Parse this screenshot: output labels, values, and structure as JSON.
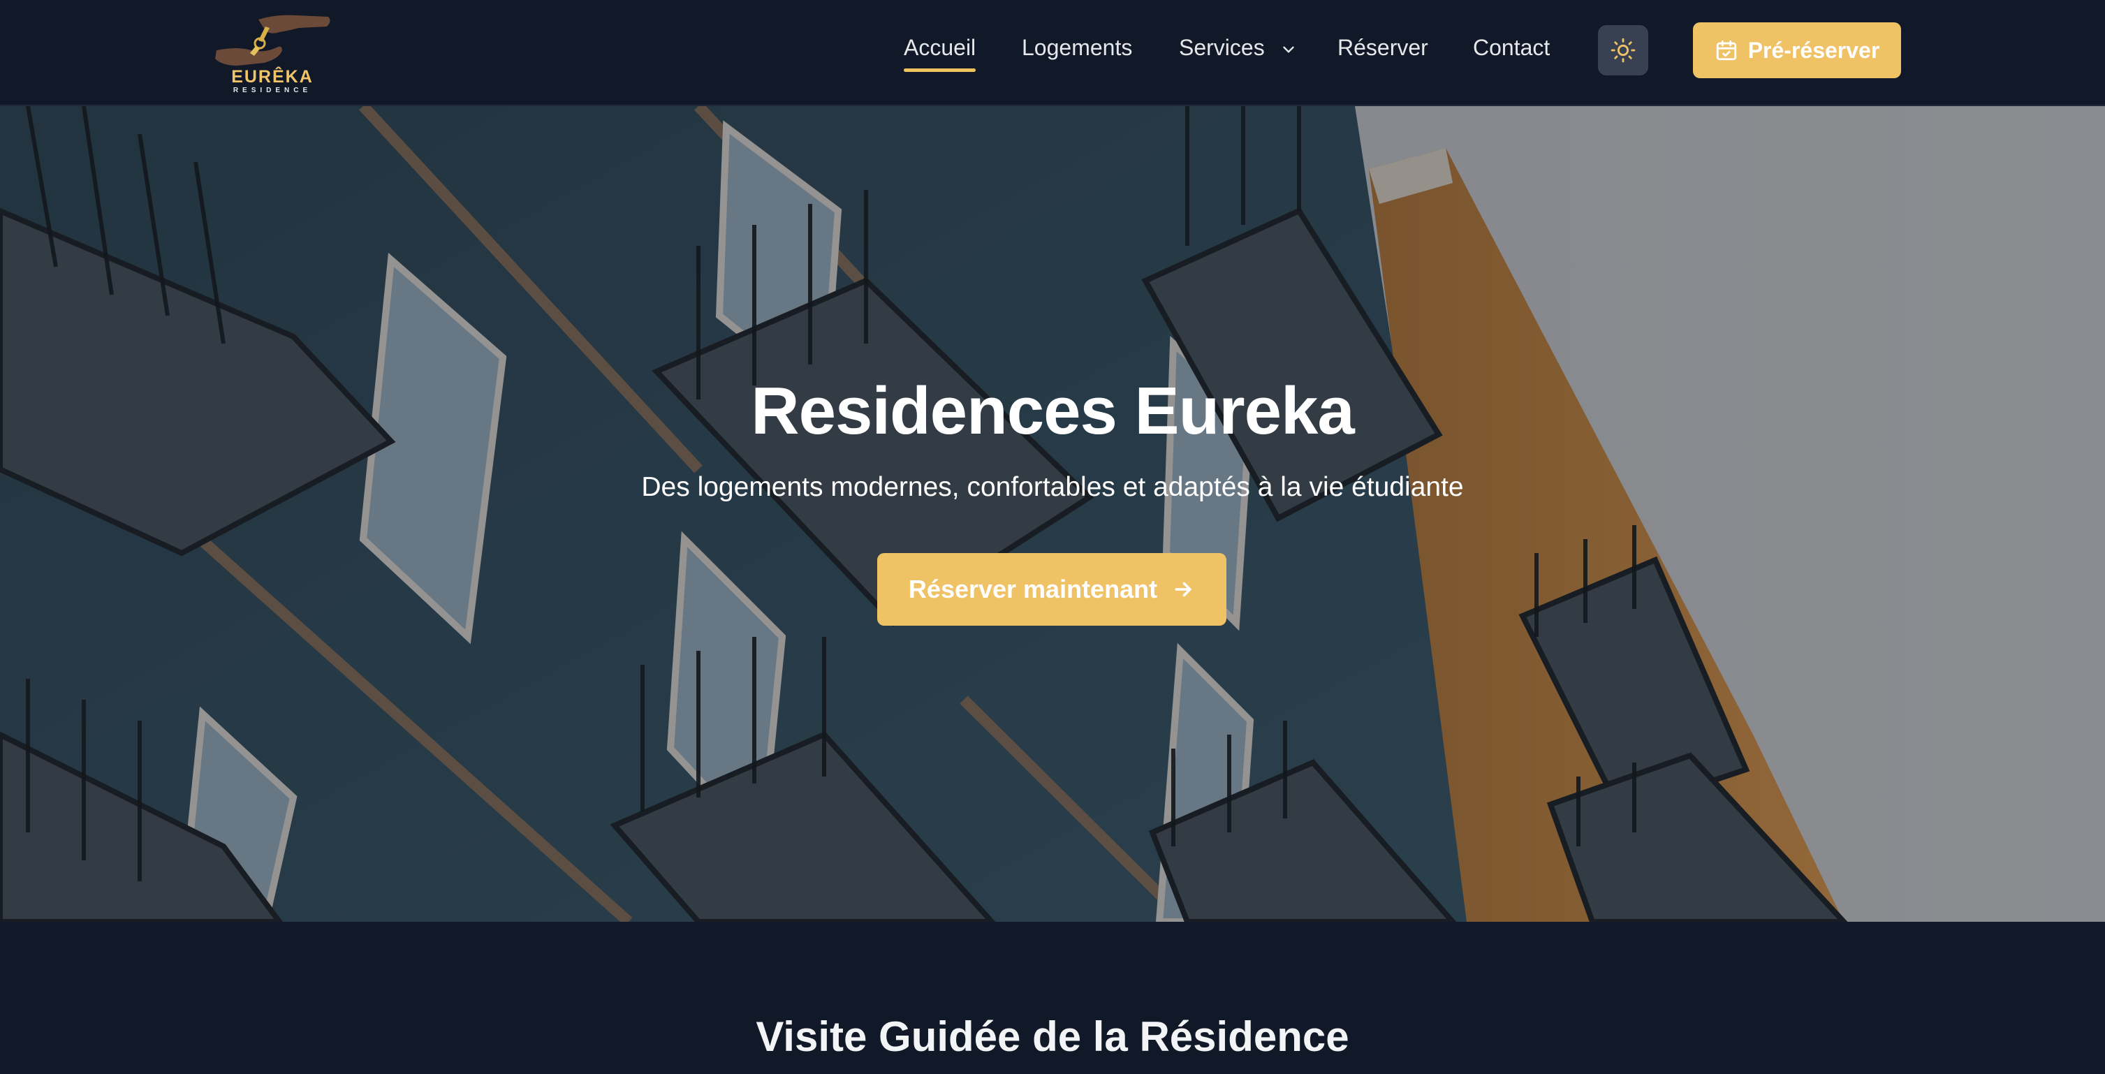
{
  "brand": {
    "name": "EURÊKA",
    "tagline": "RESIDENCE"
  },
  "nav": {
    "items": [
      {
        "label": "Accueil",
        "active": true
      },
      {
        "label": "Logements",
        "active": false
      },
      {
        "label": "Services",
        "active": false,
        "has_dropdown": true
      },
      {
        "label": "Réserver",
        "active": false
      },
      {
        "label": "Contact",
        "active": false
      }
    ],
    "theme_toggle_icon": "sun-icon",
    "prebook_label": "Pré-réserver",
    "prebook_icon": "calendar-check-icon"
  },
  "hero": {
    "title": "Residences Eureka",
    "subtitle": "Des logements modernes, confortables et adaptés à la vie étudiante",
    "cta_label": "Réserver maintenant",
    "cta_icon": "arrow-right-icon"
  },
  "tour": {
    "title": "Visite Guidée de la Résidence"
  },
  "colors": {
    "background": "#111827",
    "accent": "#f0c266",
    "text": "#e5e7eb"
  }
}
